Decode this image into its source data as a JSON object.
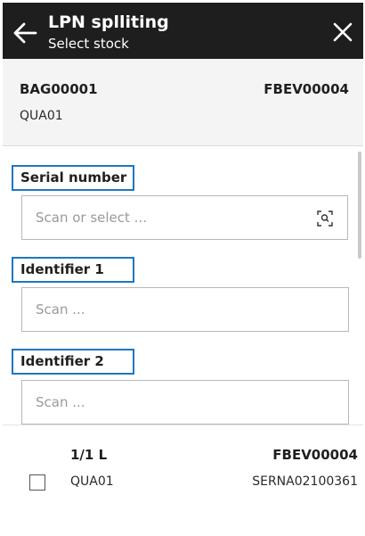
{
  "header": {
    "title": "LPN splliting",
    "subtitle": "Select stock"
  },
  "info": {
    "left_code": "BAG00001",
    "right_code": "FBEV00004",
    "sub_code": "QUA01"
  },
  "form": {
    "fields": [
      {
        "label": "Serial number",
        "placeholder": "Scan or select ..."
      },
      {
        "label": "Identifier 1",
        "placeholder": "Scan ..."
      },
      {
        "label": "Identifier 2",
        "placeholder": "Scan ..."
      }
    ]
  },
  "card": {
    "quantity": "1/1 L",
    "code": "FBEV00004",
    "sub_code": "QUA01",
    "serial": "SERNA02100361",
    "checked": false
  },
  "colors": {
    "header_bg": "#1e1e1e",
    "label_highlight": "#1f77c0"
  },
  "icons": [
    "arrow-left-icon",
    "close-icon",
    "scan-search-icon"
  ]
}
